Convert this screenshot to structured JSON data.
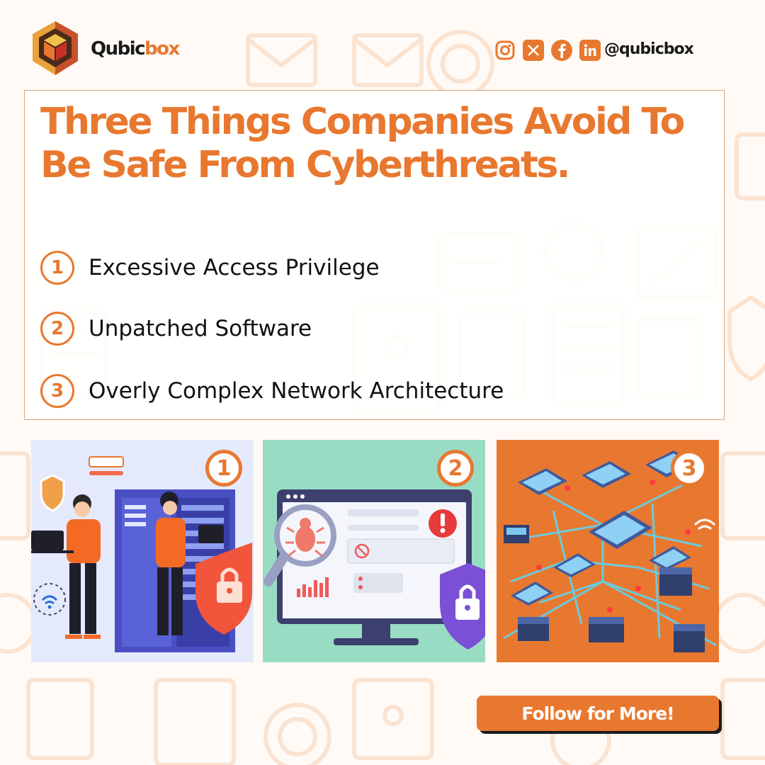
{
  "brand": {
    "name_main": "Qubic",
    "name_accent": "box",
    "handle": "@qubicbox",
    "social_icons": [
      "instagram-icon",
      "x-icon",
      "facebook-icon",
      "linkedin-icon"
    ],
    "colors": {
      "accent": "#e8782f",
      "dark": "#1a1a1a",
      "border": "#d9a77e"
    }
  },
  "headline": "Three Things Companies Avoid To Be Safe From Cyberthreats.",
  "items": [
    {
      "number": "1",
      "label": "Excessive Access Privilege"
    },
    {
      "number": "2",
      "label": "Unpatched Software"
    },
    {
      "number": "3",
      "label": "Overly Complex Network Architecture"
    }
  ],
  "panels": [
    {
      "number": "1",
      "background": "#e4eafc"
    },
    {
      "number": "2",
      "background": "#99dcc4"
    },
    {
      "number": "3",
      "background": "#e8782f"
    }
  ],
  "cta": {
    "label": "Follow for More!"
  }
}
